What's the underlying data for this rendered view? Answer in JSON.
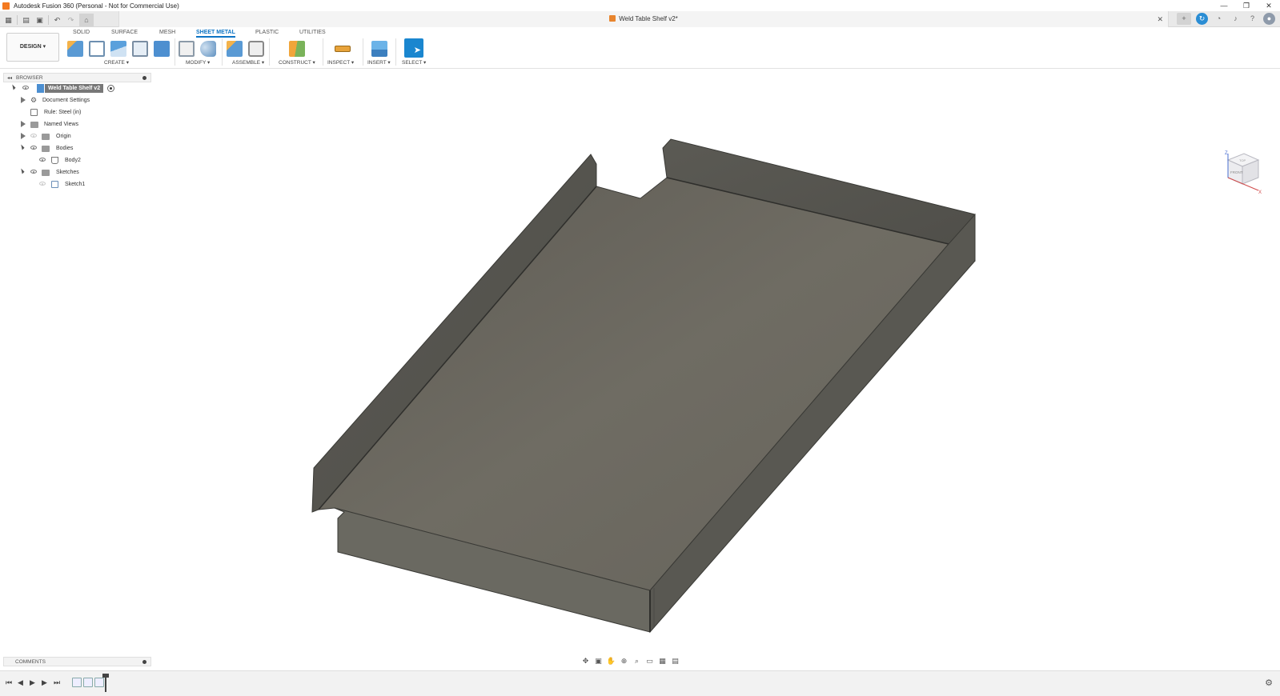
{
  "window": {
    "title": "Autodesk Fusion 360 (Personal - Not for Commercial Use)",
    "controls": [
      "—",
      "❐",
      "✕"
    ]
  },
  "document": {
    "tab_title": "Weld Table Shelf v2*",
    "close": "✕"
  },
  "quick_access": {
    "icons": [
      "data-panel-icon",
      "file-icon",
      "save-icon",
      "undo-icon",
      "redo-icon",
      "home-icon"
    ]
  },
  "ribbon": {
    "workspace": "DESIGN ▾",
    "tabs": [
      "SOLID",
      "SURFACE",
      "MESH",
      "SHEET METAL",
      "PLASTIC",
      "UTILITIES"
    ],
    "active_tab": "SHEET METAL",
    "groups": [
      "CREATE ▾",
      "MODIFY ▾",
      "ASSEMBLE ▾",
      "CONSTRUCT ▾",
      "INSPECT ▾",
      "INSERT ▾",
      "SELECT ▾"
    ]
  },
  "browser": {
    "title": "BROWSER",
    "root": "Weld Table Shelf v2",
    "items": [
      {
        "label": "Document Settings",
        "icon": "gear-icon"
      },
      {
        "label": "Rule: Steel (in)",
        "icon": "rule-icon"
      },
      {
        "label": "Named Views",
        "icon": "folder-icon"
      },
      {
        "label": "Origin",
        "icon": "folder-icon"
      },
      {
        "label": "Bodies",
        "icon": "folder-icon"
      },
      {
        "label": "Body2",
        "icon": "sheet-metal-body-icon"
      },
      {
        "label": "Sketches",
        "icon": "folder-icon"
      },
      {
        "label": "Sketch1",
        "icon": "sketch-icon"
      }
    ]
  },
  "viewcube": {
    "top": "TOP",
    "front": "FRONT",
    "axis_z": "Z",
    "axis_x": "X"
  },
  "comments": {
    "title": "COMMENTS"
  },
  "colors": {
    "accent": "#0d74c4",
    "model_face": "#6d6a62",
    "model_edge": "#3a3a36",
    "panel_bg": "#f3f3f3"
  }
}
